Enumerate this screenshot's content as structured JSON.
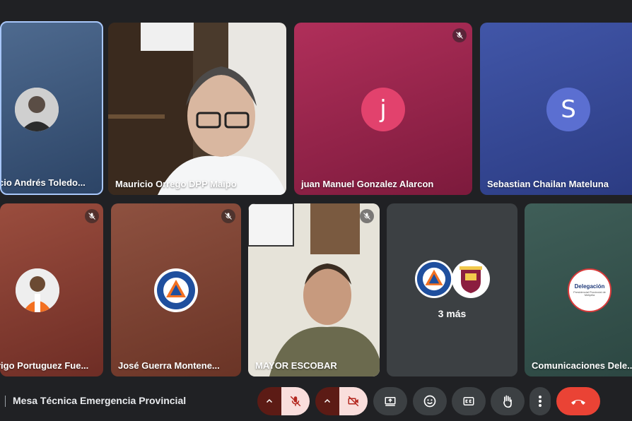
{
  "participants": [
    {
      "name": "cio Andrés Toledo...",
      "muted": false
    },
    {
      "name": "Mauricio Orrego DPP Maipo",
      "muted": false
    },
    {
      "name": "juan Manuel Gonzalez Alarcon",
      "muted": true,
      "initial": "j"
    },
    {
      "name": "Sebastian Chailan Mateluna",
      "muted": false,
      "initial": "S"
    },
    {
      "name": "rigo Portuguez Fue...",
      "muted": true
    },
    {
      "name": "José Guerra Montene...",
      "muted": true
    },
    {
      "name": "MAYOR ESCOBAR",
      "muted": true
    },
    {
      "more_label": "3 más"
    },
    {
      "name": "Comunicaciones Dele...",
      "logo_text": "Delegación",
      "logo_subtext": "Presidencial Provincial de Melipilla"
    }
  ],
  "meeting": {
    "title": "Mesa Técnica Emergencia Provincial"
  },
  "colors": {
    "end_call": "#ea4335",
    "mic_off_bg": "#f9dedc",
    "mic_off_icon": "#b3261e"
  },
  "controls": [
    "chevron-up",
    "mic-off",
    "chevron-up",
    "camera-off",
    "present",
    "emoji",
    "captions",
    "raise-hand",
    "more",
    "end-call"
  ]
}
